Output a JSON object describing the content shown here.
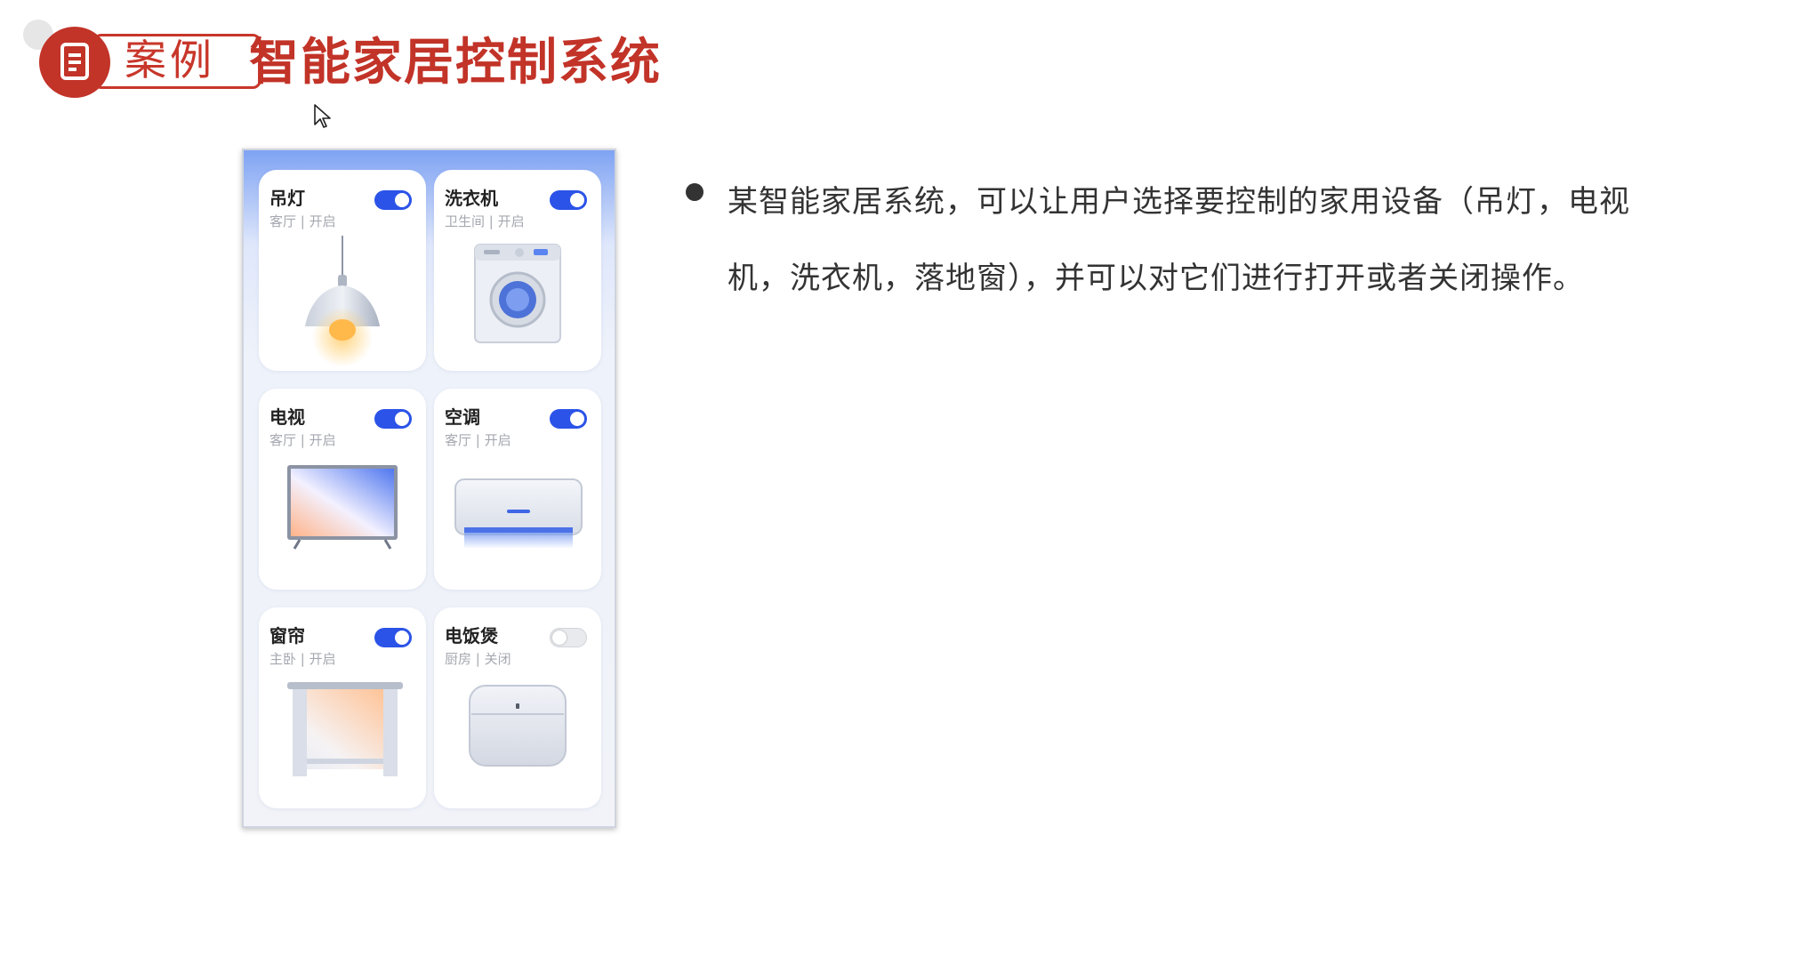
{
  "header": {
    "badge_label": "案例",
    "badge_icon": "document-icon",
    "title": "智能家居控制系统"
  },
  "colors": {
    "brand_red": "#c23328",
    "toggle_on": "#2b53e8",
    "toggle_off": "#e9eaee"
  },
  "devices": [
    {
      "name": "吊灯",
      "subtitle": "客厅 | 开启",
      "on": true,
      "icon": "pendant-lamp-icon"
    },
    {
      "name": "洗衣机",
      "subtitle": "卫生间 | 开启",
      "on": true,
      "icon": "washing-machine-icon"
    },
    {
      "name": "电视",
      "subtitle": "客厅 | 开启",
      "on": true,
      "icon": "tv-icon"
    },
    {
      "name": "空调",
      "subtitle": "客厅 | 开启",
      "on": true,
      "icon": "air-conditioner-icon"
    },
    {
      "name": "窗帘",
      "subtitle": "主卧 | 开启",
      "on": true,
      "icon": "curtain-icon"
    },
    {
      "name": "电饭煲",
      "subtitle": "厨房 | 关闭",
      "on": false,
      "icon": "rice-cooker-icon"
    }
  ],
  "description": "某智能家居系统，可以让用户选择要控制的家用设备（吊灯，电视机，洗衣机，落地窗），并可以对它们进行打开或者关闭操作。"
}
